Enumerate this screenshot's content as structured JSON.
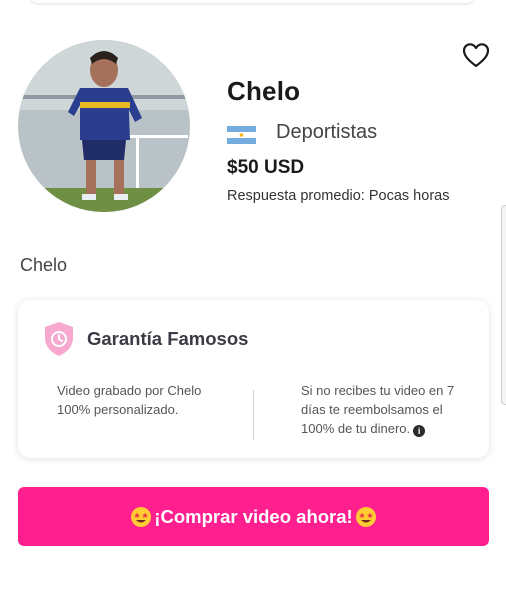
{
  "profile": {
    "name": "Chelo",
    "category": "Deportistas",
    "price": "$50 USD",
    "response": "Respuesta promedio: Pocas horas",
    "bio": "Chelo",
    "country_flag": "argentina-flag-icon"
  },
  "guarantee": {
    "title": "Garantía Famosos",
    "left_text": "Video grabado por Chelo 100% personalizado.",
    "right_text": "Si no recibes tu video en 7 días te reembolsamos el 100% de tu dinero."
  },
  "cta": {
    "label": "¡Comprar video ahora!"
  },
  "colors": {
    "accent": "#ff1f8e",
    "shield": "#f7a9cf"
  }
}
